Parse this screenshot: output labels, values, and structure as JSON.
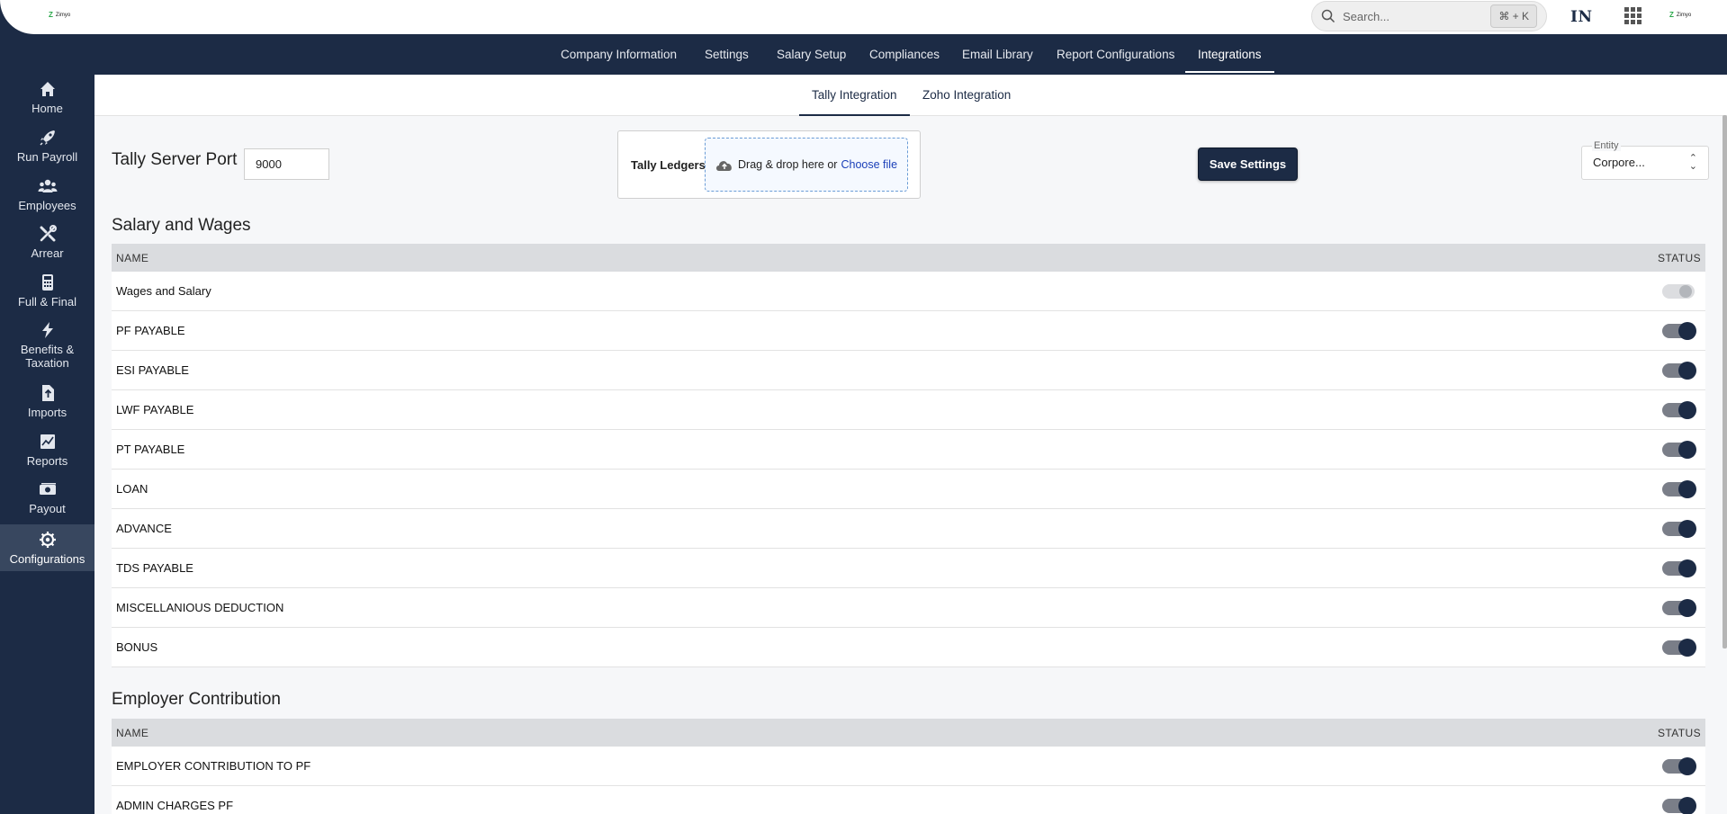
{
  "header": {
    "logo_text": "Zimyo",
    "search_placeholder": "Search...",
    "search_shortcut": "⌘ + K",
    "language": "IN",
    "apps_icon": "grid-icon",
    "logo_right_text": "Zimyo"
  },
  "topnav": {
    "items": [
      {
        "label": "Company Information"
      },
      {
        "label": "Settings"
      },
      {
        "label": "Salary Setup"
      },
      {
        "label": "Compliances"
      },
      {
        "label": "Email Library"
      },
      {
        "label": "Report Configurations"
      },
      {
        "label": "Integrations"
      }
    ],
    "active": "Integrations"
  },
  "sidebar": {
    "items": [
      {
        "label": "Home",
        "icon": "home-icon"
      },
      {
        "label": "Run Payroll",
        "icon": "rocket-icon"
      },
      {
        "label": "Employees",
        "icon": "users-icon"
      },
      {
        "label": "Arrear",
        "icon": "tools-icon"
      },
      {
        "label": "Full & Final",
        "icon": "calculator-icon"
      },
      {
        "label": "Benefits &",
        "label2": "Taxation",
        "icon": "bolt-icon"
      },
      {
        "label": "Imports",
        "icon": "file-import-icon"
      },
      {
        "label": "Reports",
        "icon": "chart-icon"
      },
      {
        "label": "Payout",
        "icon": "money-icon"
      },
      {
        "label": "Configurations",
        "icon": "gear-icon"
      }
    ],
    "active": "Configurations"
  },
  "subtabs": {
    "items": [
      {
        "label": "Tally Integration"
      },
      {
        "label": "Zoho Integration"
      }
    ],
    "active": "Tally Integration"
  },
  "tally": {
    "port_label": "Tally Server Port",
    "port_value": "9000",
    "ledgers_label": "Tally Ledgers",
    "drop_text": "Drag & drop here or",
    "choose_file": "Choose file",
    "save_label": "Save Settings",
    "entity_legend": "Entity",
    "entity_value": "Corpore..."
  },
  "salary_wages": {
    "title": "Salary and Wages",
    "col_name": "NAME",
    "col_status": "STATUS",
    "rows": [
      {
        "name": "Wages and Salary",
        "enabled": true,
        "disabled": true
      },
      {
        "name": "PF PAYABLE",
        "enabled": true,
        "disabled": false
      },
      {
        "name": "ESI PAYABLE",
        "enabled": true,
        "disabled": false
      },
      {
        "name": "LWF PAYABLE",
        "enabled": true,
        "disabled": false
      },
      {
        "name": "PT PAYABLE",
        "enabled": true,
        "disabled": false
      },
      {
        "name": "LOAN",
        "enabled": true,
        "disabled": false
      },
      {
        "name": "ADVANCE",
        "enabled": true,
        "disabled": false
      },
      {
        "name": "TDS PAYABLE",
        "enabled": true,
        "disabled": false
      },
      {
        "name": "MISCELLANIOUS DEDUCTION",
        "enabled": true,
        "disabled": false
      },
      {
        "name": "BONUS",
        "enabled": true,
        "disabled": false
      }
    ]
  },
  "employer_contribution": {
    "title": "Employer Contribution",
    "col_name": "NAME",
    "col_status": "STATUS",
    "rows": [
      {
        "name": "EMPLOYER CONTRIBUTION TO PF",
        "enabled": true,
        "disabled": false
      },
      {
        "name": "ADMIN CHARGES PF",
        "enabled": true,
        "disabled": false
      }
    ]
  },
  "colors": {
    "navy": "#1c2b45",
    "toggle_track": "#7a7e88",
    "link": "#1a3fb8"
  }
}
